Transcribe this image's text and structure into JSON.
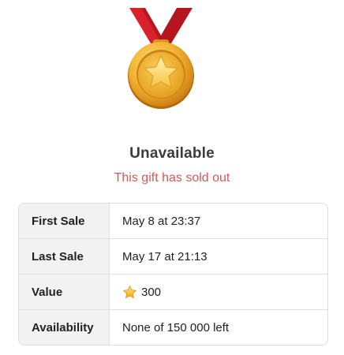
{
  "header": {
    "icon": "gold-medal-icon",
    "title": "Unavailable",
    "subtitle": "This gift has sold out"
  },
  "colors": {
    "title": "#3b3b3b",
    "subtitle": "#d05a57",
    "ribbon": "#d8212a",
    "medal_gold": "#f2b231",
    "label_background": "#f2f2f2"
  },
  "details": {
    "first_sale": {
      "label": "First Sale",
      "value": "May 8 at 23:37"
    },
    "last_sale": {
      "label": "Last Sale",
      "value": "May 17 at 21:13"
    },
    "value": {
      "label": "Value",
      "icon": "star-icon",
      "value": "300"
    },
    "availability": {
      "label": "Availability",
      "value": "None of 150 000 left"
    }
  }
}
